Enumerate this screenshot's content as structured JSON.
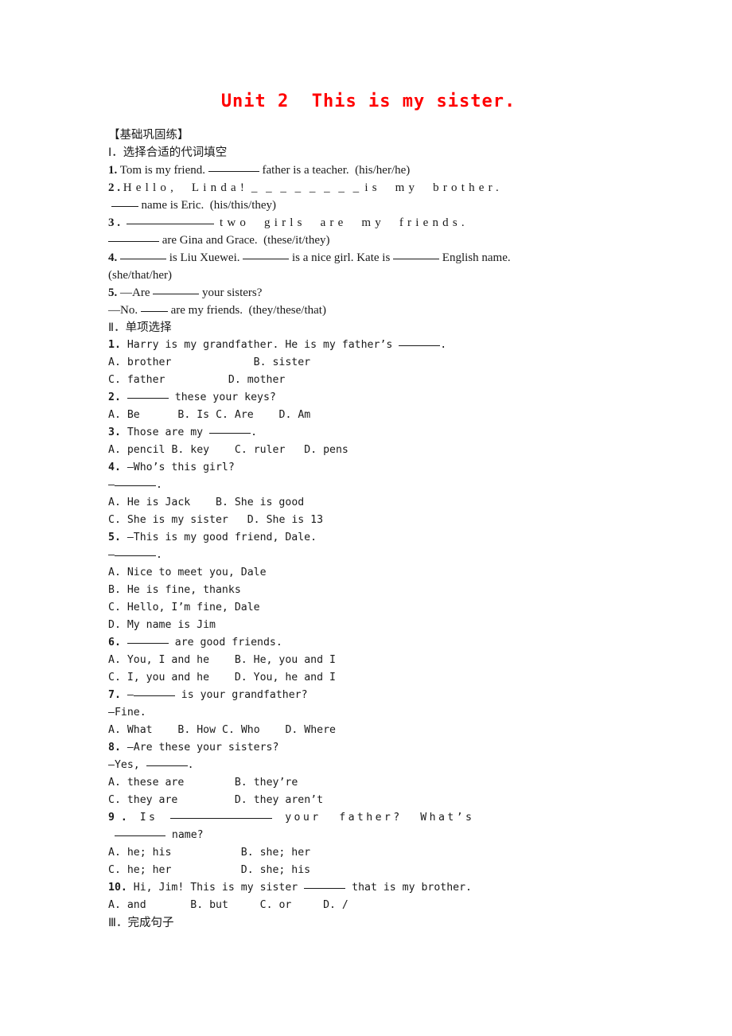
{
  "document": {
    "title": "Unit 2  This is my sister.",
    "title_color": "#ff0000",
    "header_bracket": "【基础巩固练】"
  },
  "sections": [
    {
      "heading": "Ⅰ．选择合适的代词填空",
      "items": [
        {
          "number": "1.",
          "line1_a": "Tom is my friend.",
          "line1_b": "father is a teacher.  (his/her/he)"
        },
        {
          "number": "2 .",
          "spread1": "Hello,  Linda!",
          "spread_blank": "_ _ _ _ _ _ _ _",
          "spread2": "is  my  brother.",
          "line2_b": "name is Eric.  (his/this/they)"
        },
        {
          "number": "3 .",
          "spread2": "two  girls  are  my  friends.",
          "line2_b": "are Gina and Grace.  (these/it/they)"
        },
        {
          "number": "4.",
          "part_a": "is Liu Xuewei.",
          "part_b": "is a nice girl. Kate is",
          "part_c": "English name.",
          "line2": "(she/that/her)"
        },
        {
          "number": "5.",
          "line1_a": "—Are",
          "line1_b": "your sisters?",
          "line2_a": "—No.",
          "line2_b": "are my friends.  (they/these/that)"
        }
      ]
    },
    {
      "heading": "Ⅱ．单项选择",
      "items": [
        {
          "number": "1.",
          "stem_a": "Harry is my grandfather. He is my father’s",
          "stem_b": ".",
          "options": [
            {
              "label": "A.",
              "text": "brother",
              "pad": "             "
            },
            {
              "label": "B.",
              "text": "sister",
              "pad": ""
            },
            {
              "label": "C.",
              "text": "father",
              "pad": "          "
            },
            {
              "label": "D.",
              "text": "mother",
              "pad": ""
            }
          ]
        },
        {
          "number": "2.",
          "stem_b": "these your keys?",
          "options": [
            {
              "label": "A.",
              "text": "Be",
              "pad": "      "
            },
            {
              "label": "B.",
              "text": "Is",
              "pad": " "
            },
            {
              "label": "C.",
              "text": "Are",
              "pad": "    "
            },
            {
              "label": "D.",
              "text": "Am",
              "pad": ""
            }
          ]
        },
        {
          "number": "3.",
          "stem_a": "Those are my",
          "stem_b": ".",
          "options": [
            {
              "label": "A.",
              "text": "pencil",
              "pad": " "
            },
            {
              "label": "B.",
              "text": "key",
              "pad": "    "
            },
            {
              "label": "C.",
              "text": "ruler",
              "pad": "   "
            },
            {
              "label": "D.",
              "text": "pens",
              "pad": ""
            }
          ]
        },
        {
          "number": "4.",
          "stem_a": "—Who’s this girl?",
          "answer_prefix": "—",
          "answer_suffix": ".",
          "options": [
            {
              "label": "A.",
              "text": "He is Jack",
              "pad": "    "
            },
            {
              "label": "B.",
              "text": "She is good",
              "pad": ""
            },
            {
              "label": "C.",
              "text": "She is my sister",
              "pad": "   "
            },
            {
              "label": "D.",
              "text": "She is 13",
              "pad": ""
            }
          ]
        },
        {
          "number": "5.",
          "stem_a": "—This is my good friend, Dale.",
          "answer_prefix": "—",
          "answer_suffix": ".",
          "options": [
            {
              "label": "A.",
              "text": "Nice to meet you, Dale"
            },
            {
              "label": "B.",
              "text": "He is fine, thanks"
            },
            {
              "label": "C.",
              "text": "Hello, I’m fine, Dale"
            },
            {
              "label": "D.",
              "text": "My name is Jim"
            }
          ]
        },
        {
          "number": "6.",
          "stem_b": "are good friends.",
          "options": [
            {
              "label": "A.",
              "text": "You, I and he",
              "pad": "    "
            },
            {
              "label": "B.",
              "text": "He, you and I",
              "pad": ""
            },
            {
              "label": "C.",
              "text": "I, you and he",
              "pad": "    "
            },
            {
              "label": "D.",
              "text": "You, he and I",
              "pad": ""
            }
          ]
        },
        {
          "number": "7.",
          "stem_prefix": "—",
          "stem_b": "is your grandfather?",
          "line2": "—Fine.",
          "options": [
            {
              "label": "A.",
              "text": "What",
              "pad": "    "
            },
            {
              "label": "B.",
              "text": "How",
              "pad": " "
            },
            {
              "label": "C.",
              "text": "Who",
              "pad": "    "
            },
            {
              "label": "D.",
              "text": "Where",
              "pad": ""
            }
          ]
        },
        {
          "number": "8.",
          "stem_a": "—Are these your sisters?",
          "answer_prefix": "—Yes,",
          "answer_suffix": ".",
          "options": [
            {
              "label": "A.",
              "text": "these are",
              "pad": "        "
            },
            {
              "label": "B.",
              "text": "they’re",
              "pad": ""
            },
            {
              "label": "C.",
              "text": "they are",
              "pad": "         "
            },
            {
              "label": "D.",
              "text": "they aren’t",
              "pad": ""
            }
          ]
        },
        {
          "number": "9 .",
          "spread_a": "Is",
          "spread_b": "your  father?  What’s",
          "line2_b": "name?",
          "options": [
            {
              "label": "A.",
              "text": "he; his",
              "pad": "           "
            },
            {
              "label": "B.",
              "text": "she; her",
              "pad": ""
            },
            {
              "label": "C.",
              "text": "he; her",
              "pad": "           "
            },
            {
              "label": "D.",
              "text": "she; his",
              "pad": ""
            }
          ]
        },
        {
          "number": "10.",
          "stem_a": "Hi, Jim! This is my sister",
          "stem_b": "that is my brother.",
          "options": [
            {
              "label": "A.",
              "text": "and",
              "pad": "       "
            },
            {
              "label": "B.",
              "text": "but",
              "pad": "     "
            },
            {
              "label": "C.",
              "text": "or",
              "pad": "     "
            },
            {
              "label": "D.",
              "text": "/",
              "pad": ""
            }
          ]
        }
      ]
    },
    {
      "heading": "Ⅲ．完成句子",
      "items": []
    }
  ]
}
